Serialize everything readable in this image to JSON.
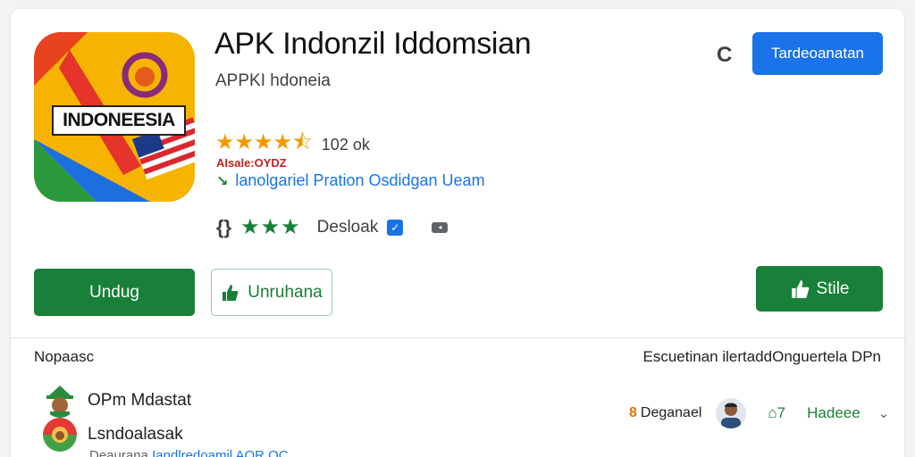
{
  "app": {
    "title": "APK Indonzil Iddomsian",
    "subtitle": "APPKI hdoneia",
    "icon_banner_text": "INDONEESIA",
    "rating_stars": "★★★★⯪",
    "rating_count": "102 ok",
    "age_label": "AIsale:OYDZ",
    "tagline": "lanolgariel Pration Osdidgan Ueam",
    "meta_bracket": "{}",
    "meta_stars": "★★★",
    "meta_label": "Desloak",
    "check_badge": "✓",
    "small_badge": "◂"
  },
  "header": {
    "refresh_icon": "C",
    "primary_button": "Tardeoanatan"
  },
  "actions": {
    "unduh_label": "Undug",
    "outline_label": "Unruhana",
    "stile_label": "Stile"
  },
  "section": {
    "left_label": "Nopaasc",
    "right_label": "Escuetinan ilertaddOnguertela DPn"
  },
  "reviews": [
    {
      "name": "OPm Mdastat"
    },
    {
      "name": "Lsndoalasak"
    }
  ],
  "review_sub": {
    "prefix": "Deaurana",
    "accent": "Iandlredoamil AOR OC"
  },
  "review_meta": {
    "badge": "8",
    "dev_label": "Deganael",
    "lock": "⌂7",
    "help": "Hadeee",
    "chevron": "⌄"
  },
  "colors": {
    "accent_blue": "#1a73e8",
    "accent_green": "#188038",
    "star_orange": "#f29900"
  }
}
